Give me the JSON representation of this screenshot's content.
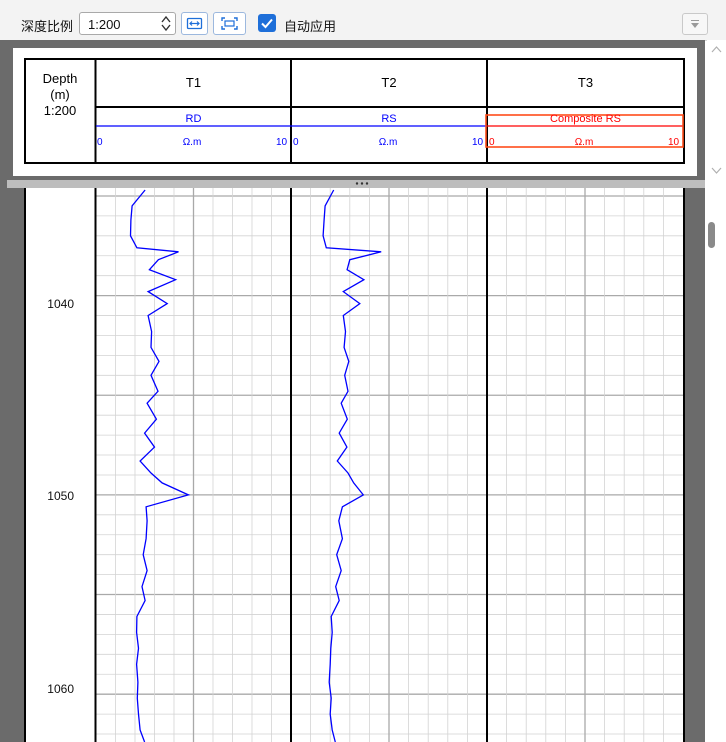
{
  "toolbar": {
    "depth_ratio_label": "深度比例",
    "scale_value": "1:200",
    "fit_width_icon": "fit-width-icon",
    "fit_page_icon": "fit-page-icon",
    "auto_apply_label": "自动应用",
    "auto_apply_checked": true,
    "filter_icon": "filter-dropdown-icon"
  },
  "header": {
    "depth_title": "Depth",
    "depth_unit": "(m)",
    "depth_scale": "1:200",
    "tracks": [
      {
        "name": "T1",
        "curve": "RD",
        "min": "0",
        "unit": "Ω.m",
        "max": "10",
        "color": "#0000ff",
        "selected": false
      },
      {
        "name": "T2",
        "curve": "RS",
        "min": "0",
        "unit": "Ω.m",
        "max": "10",
        "color": "#0000ff",
        "selected": false
      },
      {
        "name": "T3",
        "curve": "Composite RS",
        "min": "0",
        "unit": "Ω.m",
        "max": "10",
        "color": "#ff0000",
        "selected": true
      }
    ]
  },
  "depth_labels": [
    "1040",
    "1050",
    "1060"
  ],
  "colors": {
    "curve": "#0000ff",
    "selection": "#ff4d1a",
    "frame": "#6b6b6b",
    "grid_minor": "#d3d3d3",
    "grid_major": "#a9a9a9"
  },
  "chart_data": {
    "type": "line",
    "y_axis": "Depth (m)",
    "y_range": [
      1034.6,
      1062.4
    ],
    "x_range": [
      0,
      10
    ],
    "series": [
      {
        "name": "RD",
        "track": "T1",
        "color": "#0000ff",
        "points": [
          [
            1034.7,
            2.52
          ],
          [
            1035.5,
            1.85
          ],
          [
            1036.2,
            1.79
          ],
          [
            1037.0,
            1.77
          ],
          [
            1037.6,
            2.1
          ],
          [
            1037.8,
            4.23
          ],
          [
            1038.2,
            3.2
          ],
          [
            1038.7,
            2.74
          ],
          [
            1039.2,
            4.08
          ],
          [
            1039.8,
            2.67
          ],
          [
            1040.4,
            3.65
          ],
          [
            1041.0,
            2.67
          ],
          [
            1041.8,
            2.85
          ],
          [
            1042.6,
            2.82
          ],
          [
            1043.3,
            3.23
          ],
          [
            1044.0,
            2.82
          ],
          [
            1044.8,
            3.18
          ],
          [
            1045.4,
            2.62
          ],
          [
            1046.2,
            3.1
          ],
          [
            1046.9,
            2.49
          ],
          [
            1047.6,
            3.0
          ],
          [
            1048.3,
            2.26
          ],
          [
            1048.9,
            2.82
          ],
          [
            1049.4,
            3.39
          ],
          [
            1050.0,
            4.74
          ],
          [
            1050.6,
            2.57
          ],
          [
            1051.3,
            2.62
          ],
          [
            1052.2,
            2.57
          ],
          [
            1053.0,
            2.42
          ],
          [
            1053.8,
            2.62
          ],
          [
            1054.6,
            2.36
          ],
          [
            1055.3,
            2.52
          ],
          [
            1056.1,
            2.1
          ],
          [
            1056.9,
            2.08
          ],
          [
            1057.7,
            2.18
          ],
          [
            1058.5,
            2.08
          ],
          [
            1059.4,
            2.15
          ],
          [
            1060.2,
            2.12
          ],
          [
            1061.0,
            2.18
          ],
          [
            1061.8,
            2.26
          ],
          [
            1062.4,
            2.49
          ]
        ]
      },
      {
        "name": "RS",
        "track": "T2",
        "color": "#0000ff",
        "points": [
          [
            1034.7,
            2.18
          ],
          [
            1035.5,
            1.74
          ],
          [
            1036.2,
            1.69
          ],
          [
            1037.0,
            1.64
          ],
          [
            1037.6,
            1.8
          ],
          [
            1037.8,
            4.6
          ],
          [
            1038.2,
            3.0
          ],
          [
            1038.7,
            2.86
          ],
          [
            1039.2,
            3.72
          ],
          [
            1039.8,
            2.67
          ],
          [
            1040.4,
            3.51
          ],
          [
            1041.0,
            2.67
          ],
          [
            1041.8,
            2.78
          ],
          [
            1042.6,
            2.71
          ],
          [
            1043.3,
            2.95
          ],
          [
            1044.0,
            2.74
          ],
          [
            1044.8,
            2.91
          ],
          [
            1045.4,
            2.56
          ],
          [
            1046.2,
            2.87
          ],
          [
            1046.9,
            2.46
          ],
          [
            1047.6,
            2.85
          ],
          [
            1048.3,
            2.36
          ],
          [
            1048.9,
            2.91
          ],
          [
            1049.4,
            3.2
          ],
          [
            1050.0,
            3.69
          ],
          [
            1050.6,
            2.62
          ],
          [
            1051.3,
            2.44
          ],
          [
            1052.2,
            2.62
          ],
          [
            1053.0,
            2.33
          ],
          [
            1053.8,
            2.56
          ],
          [
            1054.6,
            2.28
          ],
          [
            1055.3,
            2.46
          ],
          [
            1056.1,
            2.05
          ],
          [
            1056.9,
            2.1
          ],
          [
            1057.7,
            2.03
          ],
          [
            1058.5,
            2.0
          ],
          [
            1059.4,
            1.95
          ],
          [
            1060.2,
            2.05
          ],
          [
            1061.0,
            2.0
          ],
          [
            1061.8,
            2.1
          ],
          [
            1062.4,
            2.26
          ]
        ]
      }
    ]
  }
}
